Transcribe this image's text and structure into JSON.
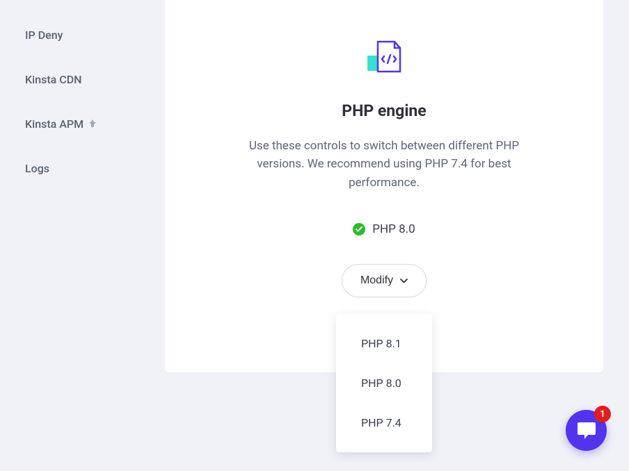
{
  "sidebar": {
    "items": [
      {
        "label": "IP Deny"
      },
      {
        "label": "Kinsta CDN"
      },
      {
        "label": "Kinsta APM"
      },
      {
        "label": "Logs"
      }
    ]
  },
  "card": {
    "title": "PHP engine",
    "description": "Use these controls to switch between different PHP versions. We recommend using PHP 7.4 for best performance.",
    "status_label": "PHP 8.0",
    "modify_label": "Modify"
  },
  "dropdown": {
    "items": [
      {
        "label": "PHP 8.1"
      },
      {
        "label": "PHP 8.0"
      },
      {
        "label": "PHP 7.4"
      }
    ]
  },
  "chat": {
    "badge_count": "1"
  }
}
